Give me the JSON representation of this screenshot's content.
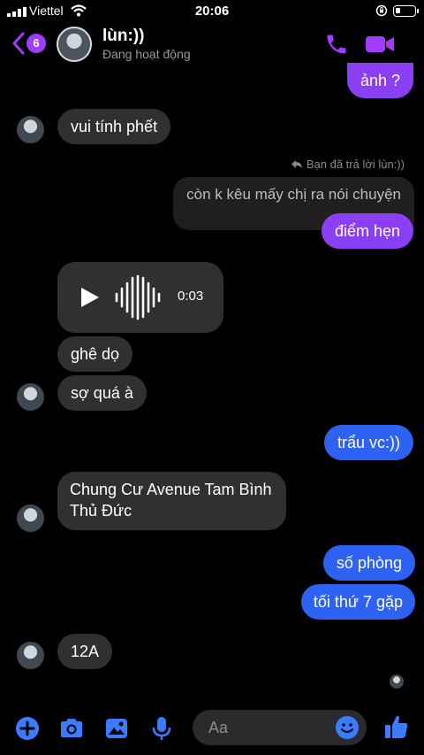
{
  "status_bar": {
    "carrier": "Viettel",
    "time": "20:06",
    "battery_level": 0.25
  },
  "header": {
    "back_count": "6",
    "contact_name": "lùn:))",
    "contact_status": "Đang hoạt động",
    "accent_color": "#a33bff"
  },
  "messages": {
    "m1": "ảnh ?",
    "m2": "vui tính phết",
    "reply_note": "Bạn đã trả lời lùn:))",
    "reply_quote": "còn k kêu mấy chị ra nói chuyện",
    "m3": "điểm hẹn",
    "voice_duration": "0:03",
    "m4": "ghê dọ",
    "m5": "sợ quá à",
    "m6": "trẩu vc:))",
    "m7_line1": "Chung Cư Avenue Tam Bình",
    "m7_line2": "Thủ Đức",
    "m8": "số phòng",
    "m9": "tối thứ 7 gặp",
    "m10": "12A"
  },
  "composer": {
    "placeholder": "Aa",
    "icon_color": "#3a7bff"
  },
  "icons": [
    "signal-icon",
    "wifi-icon",
    "rotation-lock-icon",
    "battery-icon",
    "back-chevron-icon",
    "phone-icon",
    "video-icon",
    "play-icon",
    "waveform-icon",
    "plus-icon",
    "camera-icon",
    "image-icon",
    "microphone-icon",
    "emoji-icon",
    "thumbs-up-icon"
  ]
}
